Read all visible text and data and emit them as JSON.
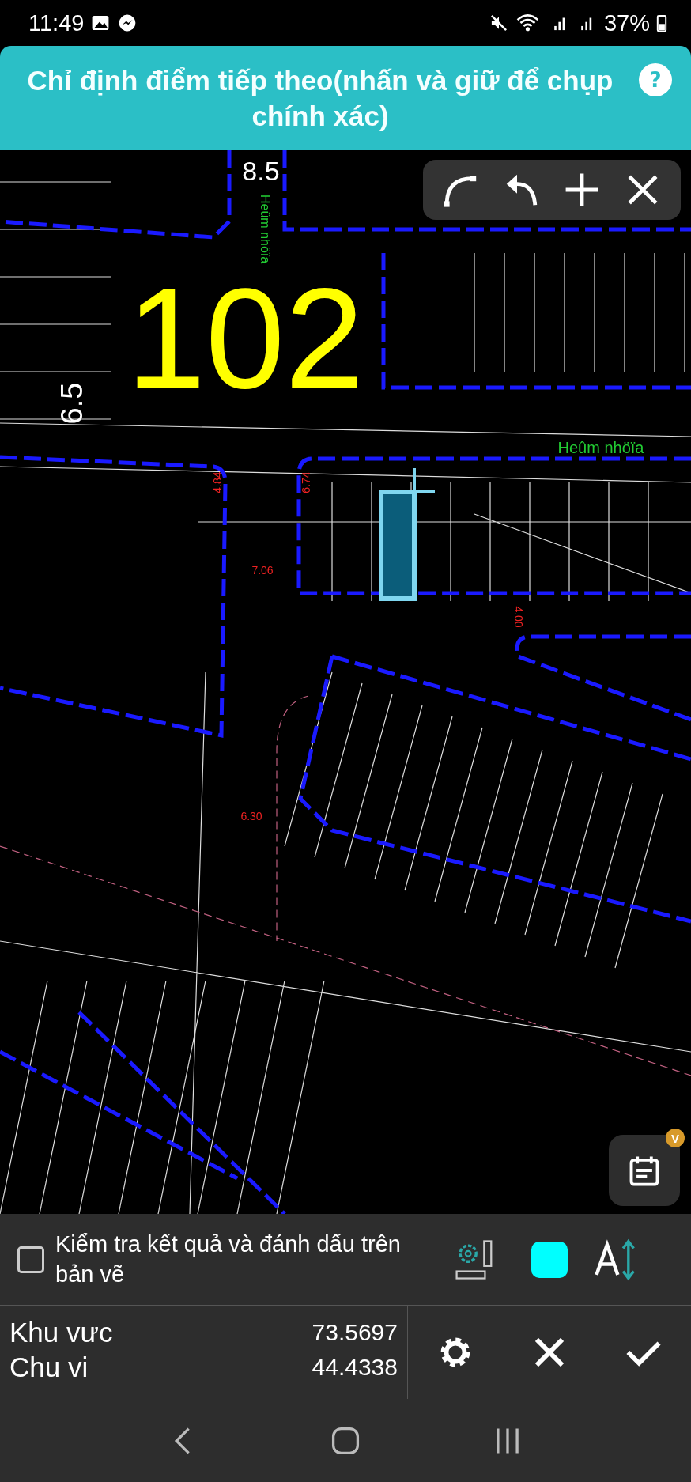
{
  "status_bar": {
    "time": "11:49",
    "battery": "37%"
  },
  "header": {
    "title": "Chỉ định điểm tiếp theo(nhấn và giữ để chụp chính xác)",
    "help": "?"
  },
  "canvas": {
    "labels": [
      {
        "kind": "measure",
        "text": "8.5"
      },
      {
        "kind": "street",
        "text": "Heûm nhöïa"
      },
      {
        "kind": "block",
        "text": "102"
      },
      {
        "kind": "measure",
        "text": "6.5"
      },
      {
        "kind": "street",
        "text": "Heûm nhöïa"
      },
      {
        "kind": "dimension",
        "text": "4.84"
      },
      {
        "kind": "dimension",
        "text": "6.74"
      },
      {
        "kind": "dimension",
        "text": "7.06"
      },
      {
        "kind": "dimension",
        "text": "4.00"
      },
      {
        "kind": "dimension",
        "text": "6.30"
      }
    ],
    "calendar_badge": "V"
  },
  "options": {
    "checkbox": {
      "label": "Kiểm tra kết quả và đánh dấu trên bản vẽ",
      "checked": false
    },
    "swatch": {
      "color": "#00ffff"
    }
  },
  "results": [
    {
      "label": "Khu vưc",
      "value": "73.5697"
    },
    {
      "label": "Chu vi",
      "value": "44.4338"
    }
  ]
}
